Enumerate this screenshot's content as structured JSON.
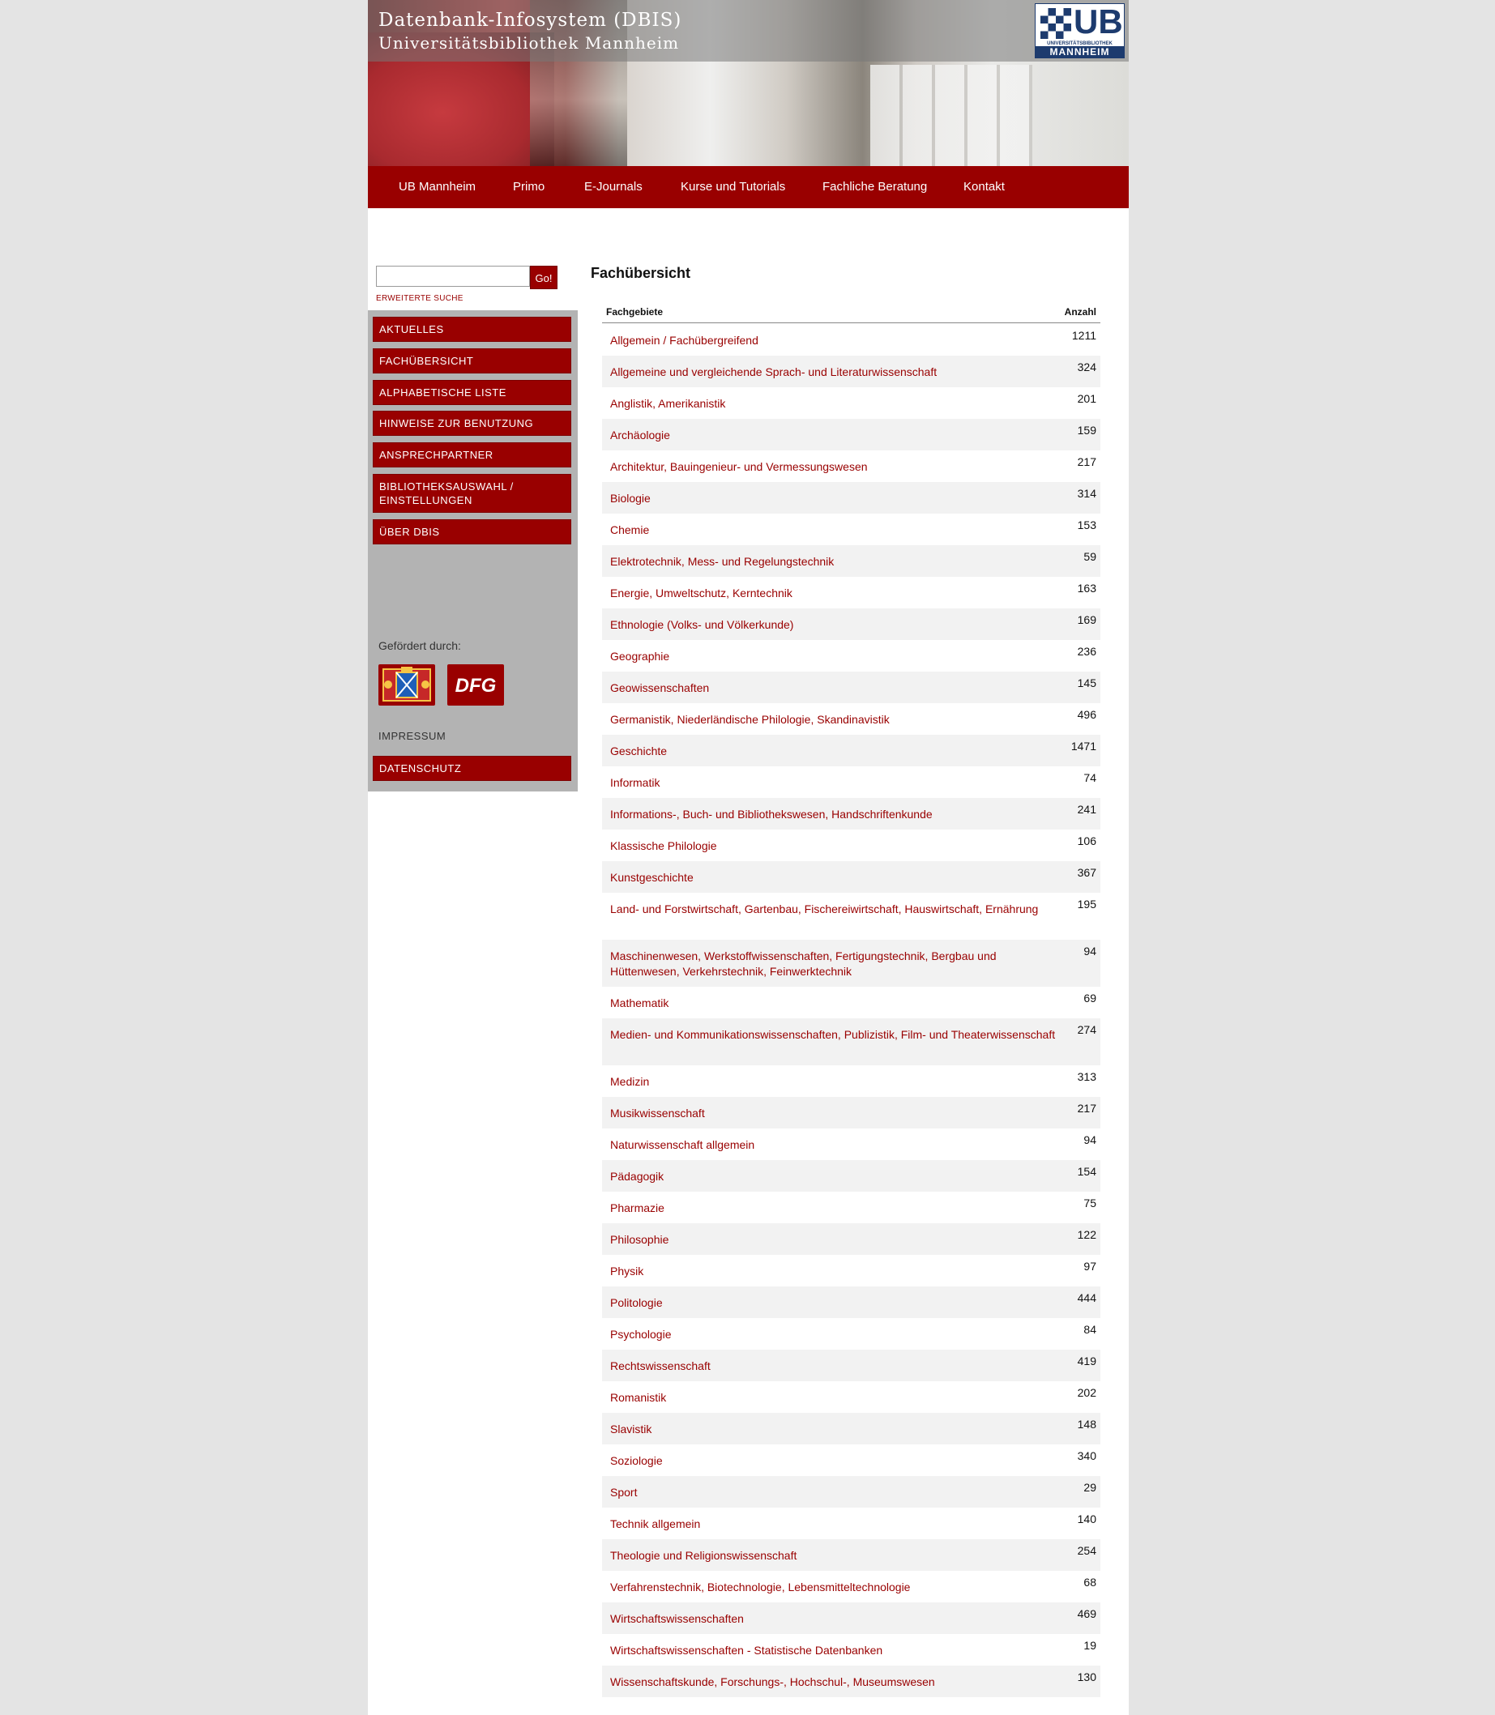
{
  "header": {
    "title": "Datenbank-Infosystem (DBIS)",
    "subtitle": "Universitätsbibliothek Mannheim",
    "logo": {
      "ub": "UB",
      "small": "UNIVERSITÄTSBIBLIOTHEK",
      "big": "MANNHEIM"
    }
  },
  "topnav": [
    "UB Mannheim",
    "Primo",
    "E-Journals",
    "Kurse und Tutorials",
    "Fachliche Beratung",
    "Kontakt"
  ],
  "search": {
    "go_label": "Go!",
    "advanced_label": "ERWEITERTE SUCHE",
    "value": ""
  },
  "sidebar": {
    "menu": [
      "AKTUELLES",
      "FACHÜBERSICHT",
      "ALPHABETISCHE LISTE",
      "HINWEISE ZUR BENUTZUNG",
      "ANSPRECHPARTNER",
      "BIBLIOTHEKSAUSWAHL / EINSTELLUNGEN",
      "ÜBER DBIS"
    ],
    "funded_by": "Gefördert durch:",
    "sponsors": [
      "Bayern-Wappen",
      "DFG"
    ],
    "impressum": "IMPRESSUM",
    "datenschutz": "DATENSCHUTZ"
  },
  "main": {
    "title": "Fachübersicht",
    "col_subject": "Fachgebiete",
    "col_count": "Anzahl",
    "rows": [
      {
        "label": "Allgemein / Fachübergreifend",
        "count": "1211"
      },
      {
        "label": "Allgemeine und vergleichende Sprach- und Literaturwissenschaft",
        "count": "324"
      },
      {
        "label": "Anglistik, Amerikanistik",
        "count": "201"
      },
      {
        "label": "Archäologie",
        "count": "159"
      },
      {
        "label": "Architektur, Bauingenieur- und Vermessungswesen",
        "count": "217"
      },
      {
        "label": "Biologie",
        "count": "314"
      },
      {
        "label": "Chemie",
        "count": "153"
      },
      {
        "label": "Elektrotechnik, Mess- und Regelungstechnik",
        "count": "59"
      },
      {
        "label": "Energie, Umweltschutz, Kerntechnik",
        "count": "163"
      },
      {
        "label": "Ethnologie (Volks- und Völkerkunde)",
        "count": "169"
      },
      {
        "label": "Geographie",
        "count": "236"
      },
      {
        "label": "Geowissenschaften",
        "count": "145"
      },
      {
        "label": "Germanistik, Niederländische Philologie, Skandinavistik",
        "count": "496"
      },
      {
        "label": "Geschichte",
        "count": "1471"
      },
      {
        "label": "Informatik",
        "count": "74"
      },
      {
        "label": "Informations-, Buch- und Bibliothekswesen, Handschriftenkunde",
        "count": "241"
      },
      {
        "label": "Klassische Philologie",
        "count": "106"
      },
      {
        "label": "Kunstgeschichte",
        "count": "367"
      },
      {
        "label": "Land- und Forstwirtschaft, Gartenbau, Fischereiwirtschaft, Hauswirtschaft, Ernährung",
        "count": "195"
      },
      {
        "label": "Maschinenwesen, Werkstoffwissenschaften, Fertigungstechnik, Bergbau und Hüttenwesen, Verkehrstechnik, Feinwerktechnik",
        "count": "94"
      },
      {
        "label": "Mathematik",
        "count": "69"
      },
      {
        "label": "Medien- und Kommunikationswissenschaften, Publizistik, Film- und Theaterwissenschaft",
        "count": "274"
      },
      {
        "label": "Medizin",
        "count": "313"
      },
      {
        "label": "Musikwissenschaft",
        "count": "217"
      },
      {
        "label": "Naturwissenschaft allgemein",
        "count": "94"
      },
      {
        "label": "Pädagogik",
        "count": "154"
      },
      {
        "label": "Pharmazie",
        "count": "75"
      },
      {
        "label": "Philosophie",
        "count": "122"
      },
      {
        "label": "Physik",
        "count": "97"
      },
      {
        "label": "Politologie",
        "count": "444"
      },
      {
        "label": "Psychologie",
        "count": "84"
      },
      {
        "label": "Rechtswissenschaft",
        "count": "419"
      },
      {
        "label": "Romanistik",
        "count": "202"
      },
      {
        "label": "Slavistik",
        "count": "148"
      },
      {
        "label": "Soziologie",
        "count": "340"
      },
      {
        "label": "Sport",
        "count": "29"
      },
      {
        "label": "Technik allgemein",
        "count": "140"
      },
      {
        "label": "Theologie und Religionswissenschaft",
        "count": "254"
      },
      {
        "label": "Verfahrenstechnik, Biotechnologie, Lebensmitteltechnologie",
        "count": "68"
      },
      {
        "label": "Wirtschaftswissenschaften",
        "count": "469"
      },
      {
        "label": "Wirtschaftswissenschaften - Statistische Datenbanken",
        "count": "19"
      },
      {
        "label": "Wissenschaftskunde, Forschungs-, Hochschul-, Museumswesen",
        "count": "130"
      }
    ]
  },
  "colors": {
    "accent": "#990000",
    "background": "#e4e4e4",
    "sidebar": "#b3b3b3",
    "row_alt": "#f2f2f2"
  }
}
